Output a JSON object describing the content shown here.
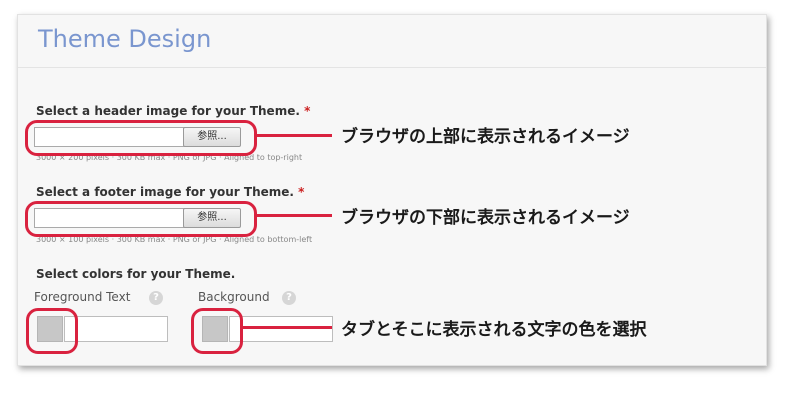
{
  "panel": {
    "title": "Theme Design"
  },
  "header_image": {
    "label": "Select a header image for your Theme.",
    "required_mark": "*",
    "browse_label": "参照...",
    "hint": "3000 × 200 pixels · 300 KB max · PNG or JPG · Aligned to top-right",
    "annotation": "ブラウザの上部に表示されるイメージ"
  },
  "footer_image": {
    "label": "Select a footer image for your Theme.",
    "required_mark": "*",
    "browse_label": "参照...",
    "hint": "3000 × 100 pixels · 300 KB max · PNG or JPG · Aligned to bottom-left",
    "annotation": "ブラウザの下部に表示されるイメージ"
  },
  "colors": {
    "label": "Select colors for your Theme.",
    "foreground_label": "Foreground Text",
    "background_label": "Background",
    "help_glyph": "?",
    "annotation": "タブとそこに表示される文字の色を選択"
  },
  "style": {
    "accent": "#d9223f",
    "title_color": "#7a96cf",
    "swatch_color": "#c7c7c7"
  }
}
